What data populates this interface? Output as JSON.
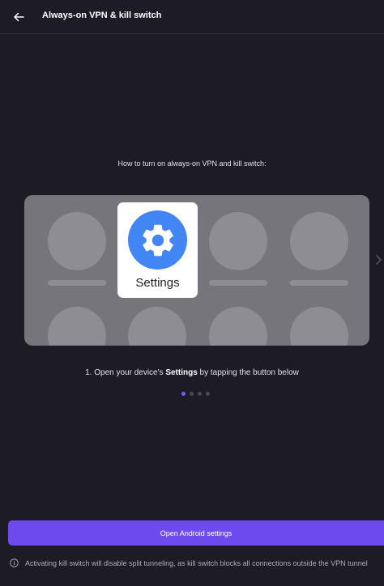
{
  "appbar": {
    "title": "Always-on VPN & kill switch",
    "back_icon": "arrow-left-icon"
  },
  "instructions": {
    "heading": "How to turn on always-on VPN and kill switch:",
    "step_prefix": "1. Open your device's ",
    "step_bold": "Settings",
    "step_suffix": " by tapping the button below"
  },
  "illustration": {
    "settings_label": "Settings",
    "settings_icon": "gear-icon",
    "settings_icon_color": "#4285f4",
    "next_icon": "chevron-right-icon"
  },
  "pager": {
    "total": 4,
    "active_index": 0,
    "active_color": "#7b5cf0"
  },
  "primary_button": {
    "label": "Open Android settings",
    "color": "#6d4aee"
  },
  "footer_note": {
    "icon": "info-icon",
    "text": "Activating kill switch will disable split tunneling, as kill switch blocks all connections outside the VPN tunnel"
  }
}
